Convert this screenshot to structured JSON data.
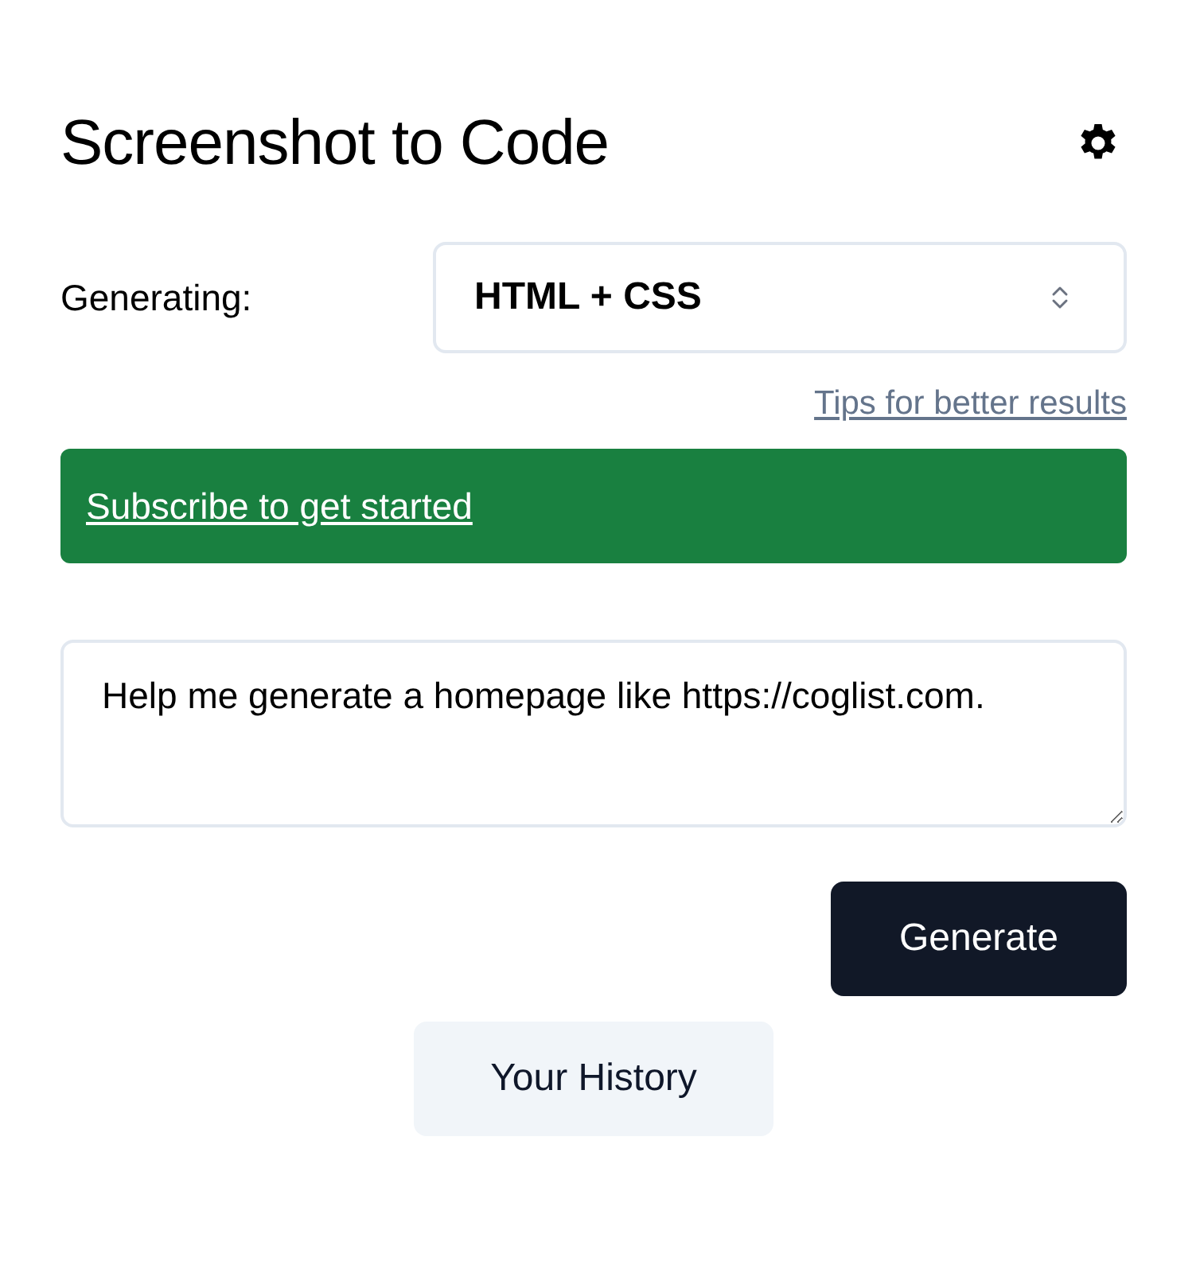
{
  "title": "Screenshot to Code",
  "settings": {
    "label": "Generating:",
    "stack": "HTML + CSS"
  },
  "tips_link": "Tips for better results",
  "subscribe_banner": {
    "link": "Subscribe to get started"
  },
  "prompt": {
    "value": "Help me generate a homepage like https://coglist.com."
  },
  "buttons": [
    {
      "kind": "primary",
      "label": "Generate"
    },
    {
      "kind": "secondary",
      "label": "Your History"
    }
  ]
}
